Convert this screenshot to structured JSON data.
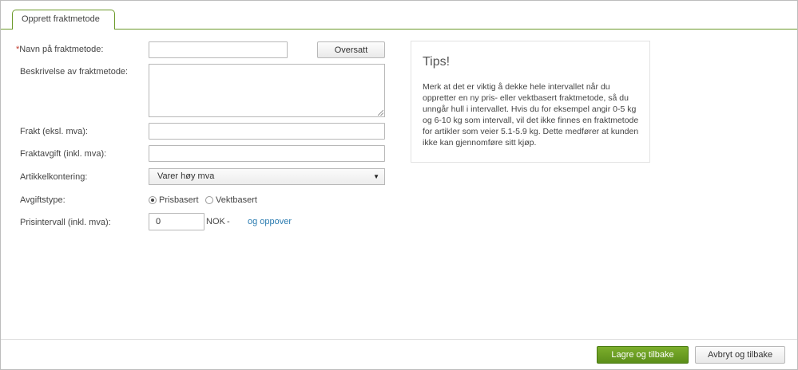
{
  "tab": {
    "label": "Opprett fraktmetode"
  },
  "form": {
    "name": {
      "required_mark": "*",
      "label": "Navn på fraktmetode:",
      "value": ""
    },
    "translate_button": "Oversatt",
    "description": {
      "label": "Beskrivelse av fraktmetode:",
      "value": ""
    },
    "freight": {
      "label": "Frakt (eksl. mva):",
      "value": ""
    },
    "freight_fee": {
      "label": "Fraktavgift (inkl. mva):",
      "value": ""
    },
    "article_account": {
      "label": "Artikkelkontering:",
      "selected": "Varer høy mva",
      "arrow": "▼"
    },
    "fee_type": {
      "label": "Avgiftstype:",
      "options": [
        {
          "label": "Prisbasert",
          "checked": true
        },
        {
          "label": "Vektbasert",
          "checked": false
        }
      ]
    },
    "price_interval": {
      "label": "Prisintervall (inkl. mva):",
      "value": "0",
      "unit": "NOK",
      "dash": "-",
      "link": "og oppover"
    }
  },
  "tips": {
    "title": "Tips!",
    "body": "Merk at det er viktig å dekke hele intervallet når du oppretter en ny pris- eller vektbasert fraktmetode, så du unngår hull i intervallet. Hvis du for eksempel angir 0-5 kg og 6-10 kg som intervall, vil det ikke finnes en fraktmetode for artikler som veier 5.1-5.9 kg. Dette medfører at kunden ikke kan gjennomføre sitt kjøp."
  },
  "footer": {
    "save_label": "Lagre og tilbake",
    "cancel_label": "Avbryt og tilbake"
  },
  "colors": {
    "accent": "#6c9a2a",
    "primary_button": "#6a9c22",
    "link": "#2a7bb0",
    "required": "#c0392b"
  }
}
